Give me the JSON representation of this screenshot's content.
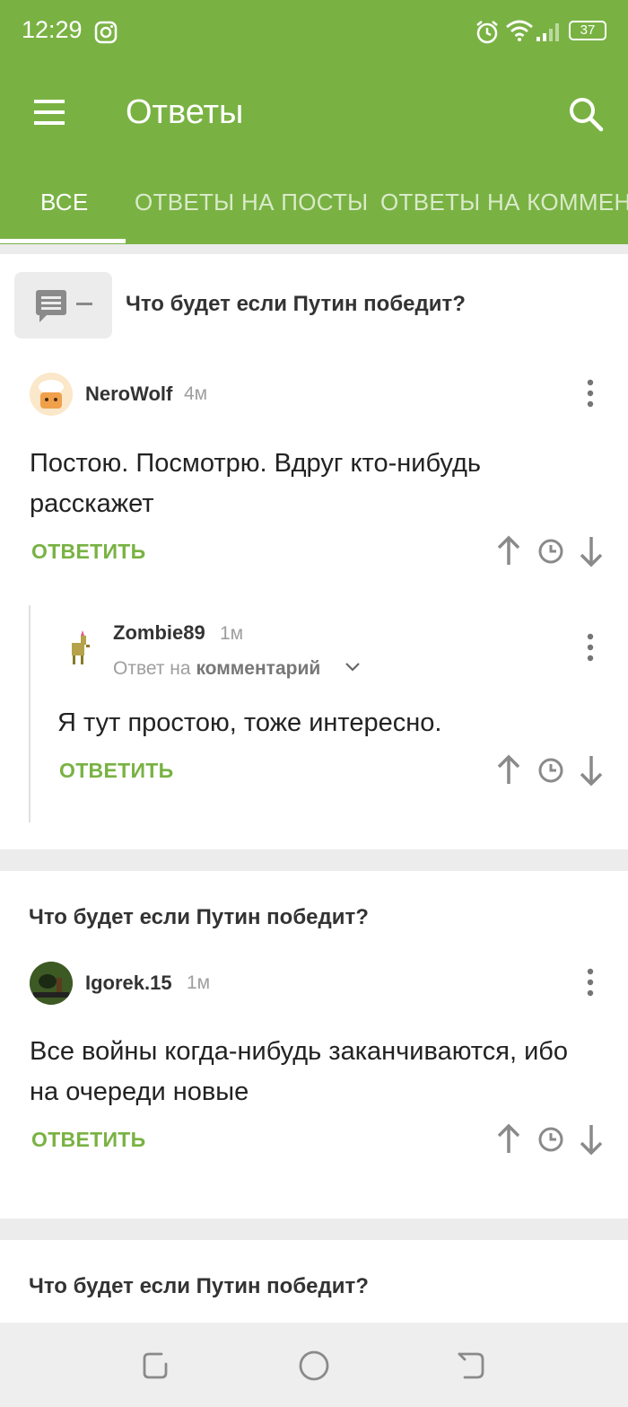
{
  "status_bar": {
    "time": "12:29",
    "battery": "37"
  },
  "toolbar": {
    "title": "Ответы"
  },
  "tabs": [
    {
      "label": "ВСЕ",
      "active": true
    },
    {
      "label": "ОТВЕТЫ НА ПОСТЫ",
      "active": false
    },
    {
      "label": "ОТВЕТЫ НА КОММЕН",
      "active": false
    }
  ],
  "colors": {
    "accent": "#79b243",
    "background": "#ececec"
  },
  "feed": [
    {
      "post_title": "Что будет если Путин победит?",
      "comment": {
        "username": "NeroWolf",
        "time": "4м",
        "text": "Постою. Посмотрю. Вдруг кто-нибудь расскажет",
        "reply_label": "ОТВЕТИТЬ"
      },
      "reply": {
        "username": "Zombie89",
        "time": "1м",
        "reply_to_prefix": "Ответ на",
        "reply_to_target": "комментарий",
        "text": "Я тут простою, тоже интересно.",
        "reply_label": "ОТВЕТИТЬ"
      }
    },
    {
      "post_title": "Что будет если Путин победит?",
      "comment": {
        "username": "Igorek.15",
        "time": "1м",
        "text": "Все войны когда-нибудь заканчиваются, ибо на очереди новые",
        "reply_label": "ОТВЕТИТЬ"
      }
    },
    {
      "post_title": "Что будет если Путин победит?"
    }
  ],
  "icons": [
    "hamburger-menu-icon",
    "search-icon",
    "comment-icon",
    "more-vert-icon",
    "arrow-up-icon",
    "clock-icon",
    "arrow-down-icon",
    "chevron-down-icon"
  ]
}
